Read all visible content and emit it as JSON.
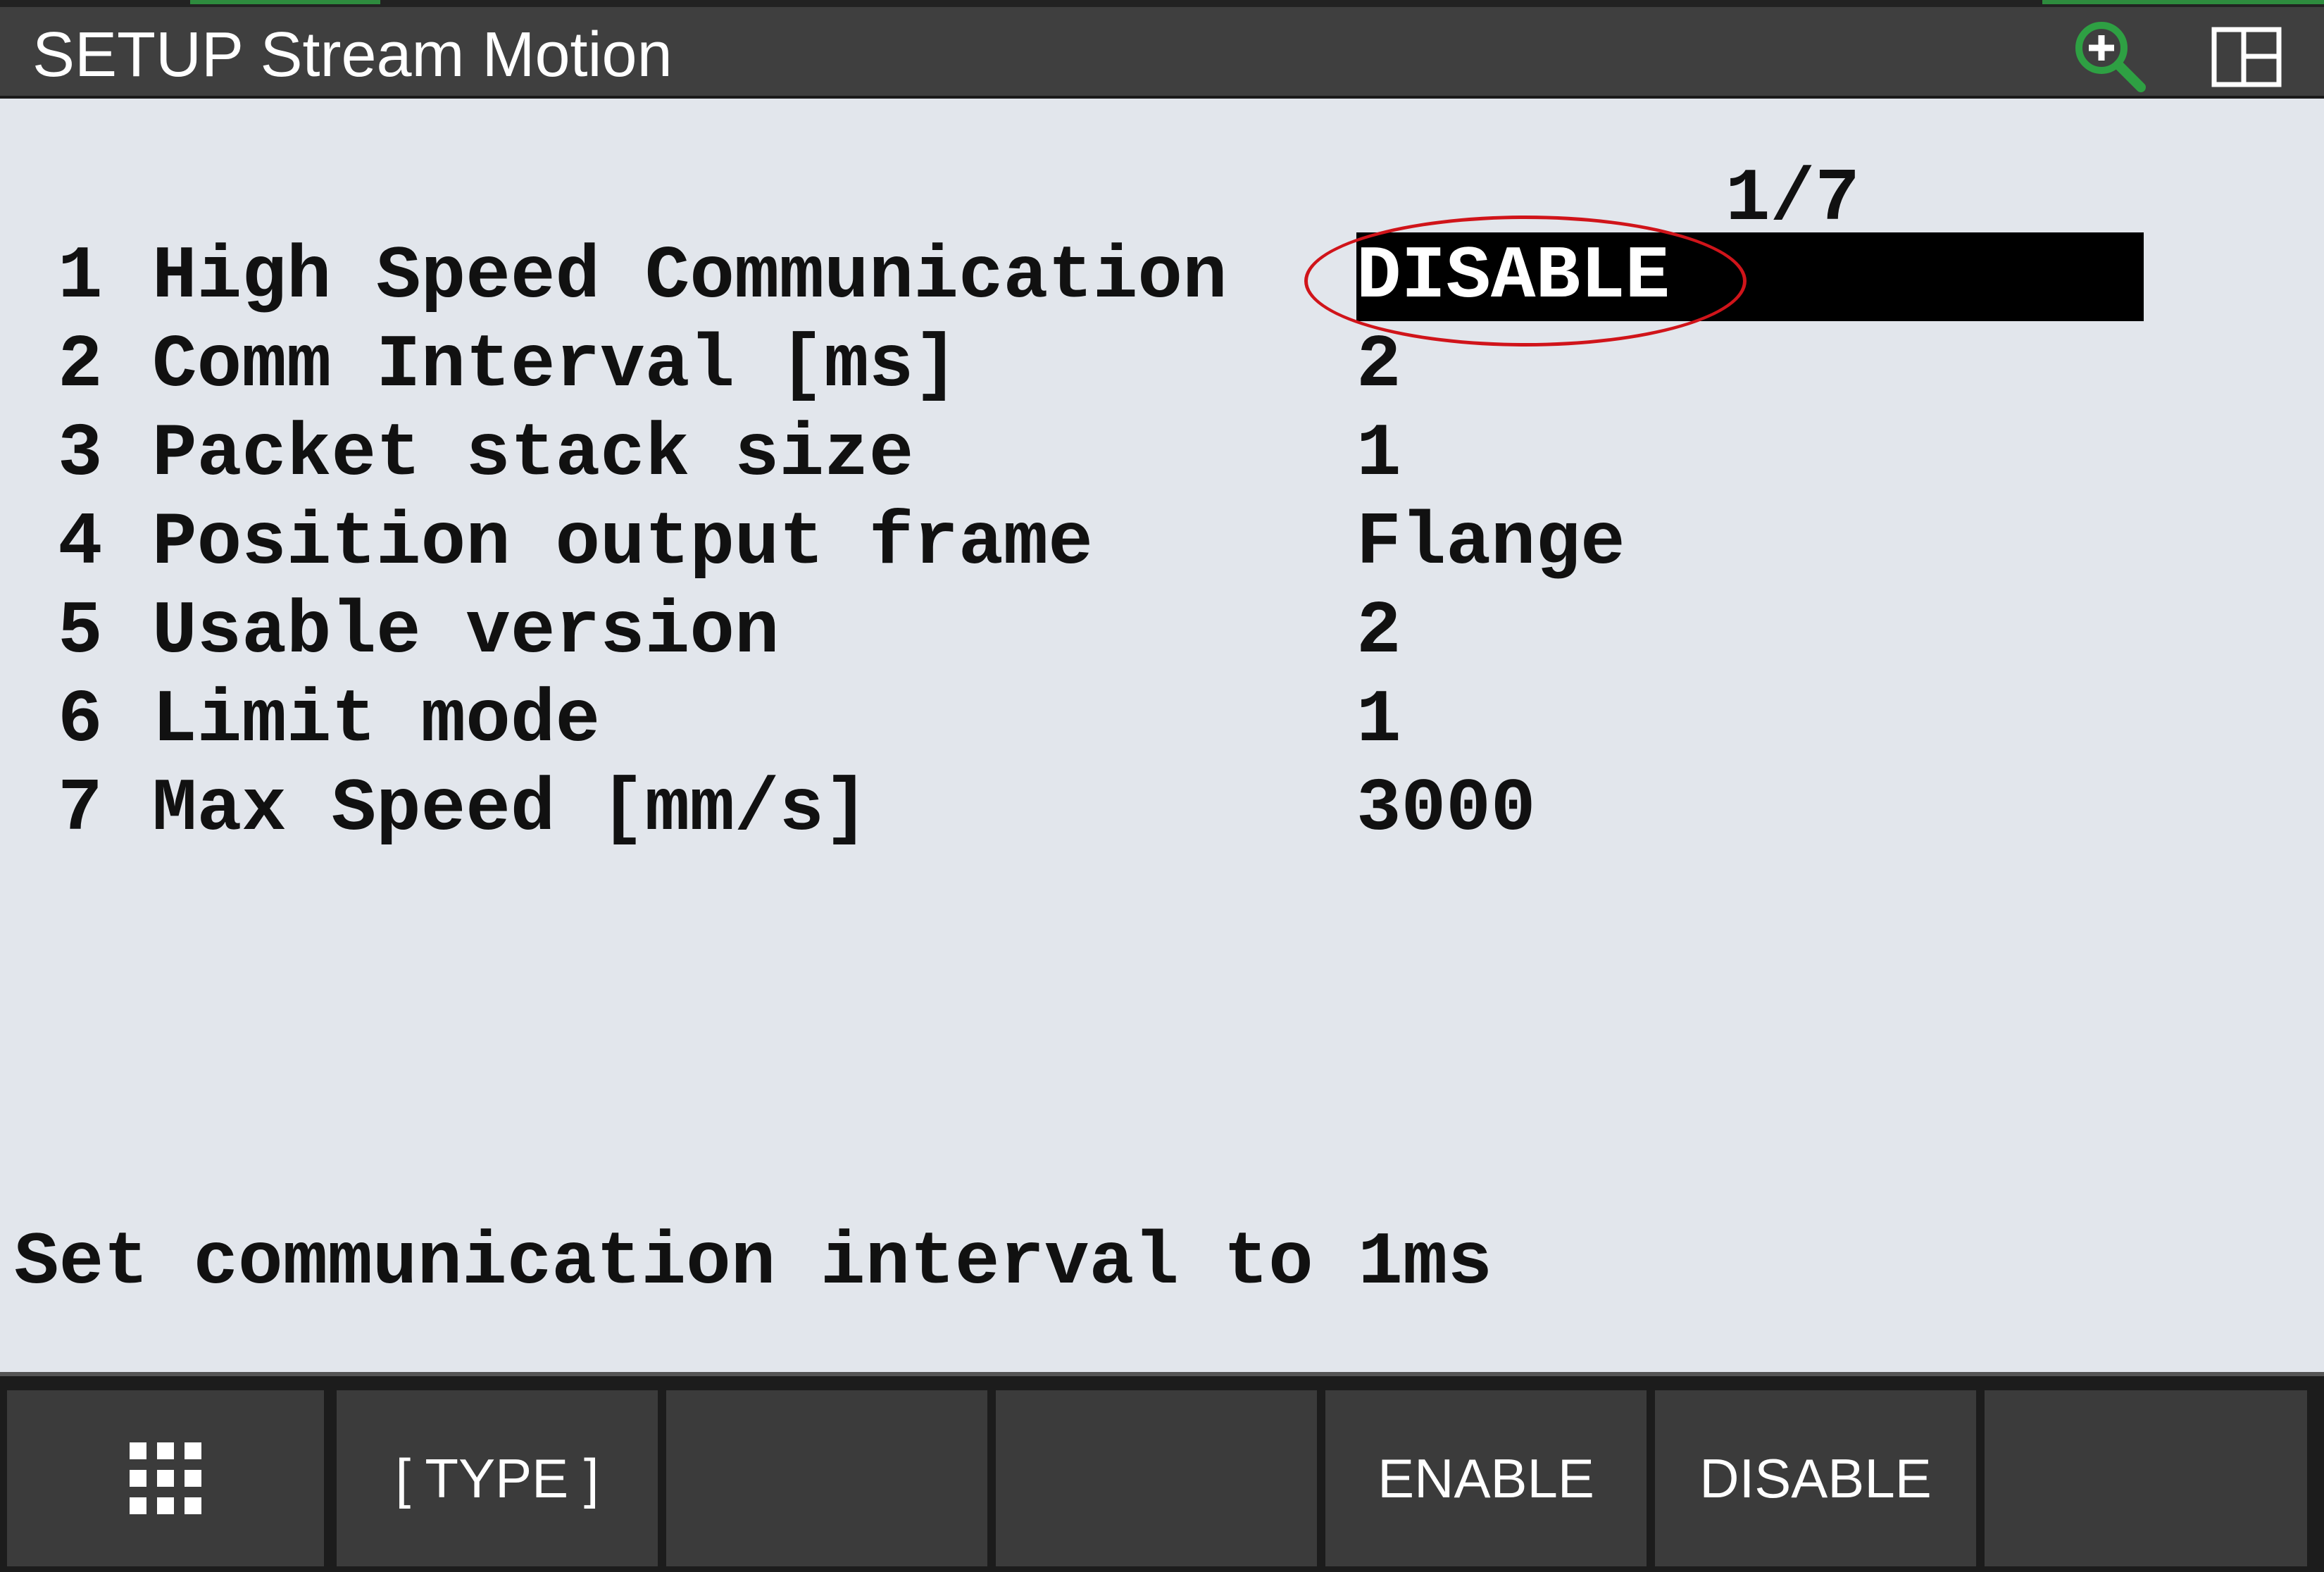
{
  "window": {
    "title": "SETUP Stream Motion",
    "zoom_icon": "zoom-in-icon",
    "layout_icon": "split-layout-icon",
    "accent_color": "#2ea043"
  },
  "page_indicator": "1/7",
  "items": [
    {
      "num": "1",
      "label": "High Speed Communication",
      "value": "DISABLE",
      "selected": true
    },
    {
      "num": "2",
      "label": "Comm Interval [ms]",
      "value": "2"
    },
    {
      "num": "3",
      "label": "Packet stack size",
      "value": "1"
    },
    {
      "num": "4",
      "label": "Position output frame",
      "value": "Flange"
    },
    {
      "num": "5",
      "label": "Usable version",
      "value": "2"
    },
    {
      "num": "6",
      "label": "Limit mode",
      "value": "1"
    },
    {
      "num": "7",
      "label": "Max Speed [mm/s]",
      "value": "3000"
    }
  ],
  "help_text": "Set communication interval to 1ms",
  "annotation": {
    "color": "#d0141a"
  },
  "function_keys": [
    {
      "label": "",
      "icon": "grid-menu-icon"
    },
    {
      "label": "[ TYPE ]"
    },
    {
      "label": ""
    },
    {
      "label": ""
    },
    {
      "label": "ENABLE"
    },
    {
      "label": "DISABLE"
    },
    {
      "label": ""
    }
  ]
}
